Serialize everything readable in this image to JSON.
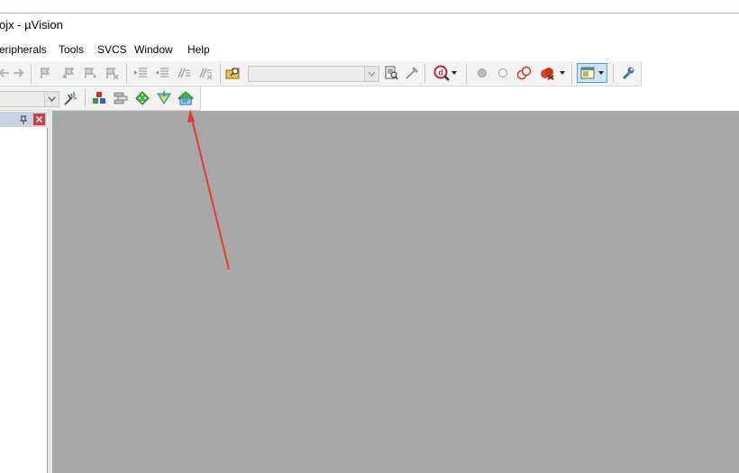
{
  "window": {
    "title": "ojx - µVision"
  },
  "menubar": {
    "items": [
      {
        "label": "eripherals"
      },
      {
        "label": "Tools"
      },
      {
        "label": "SVCS"
      },
      {
        "label": "Window"
      },
      {
        "label": "Help"
      }
    ]
  },
  "toolbar": {
    "combo_value": "",
    "target_combo_value": ""
  },
  "panel": {
    "pin_icon": "pin-icon",
    "close_icon": "close-icon"
  },
  "colors": {
    "main_area": "#a8a8a8",
    "arrow": "#e83a2c",
    "panel_header": "#c9d3e6",
    "close_button": "#c8403a"
  }
}
